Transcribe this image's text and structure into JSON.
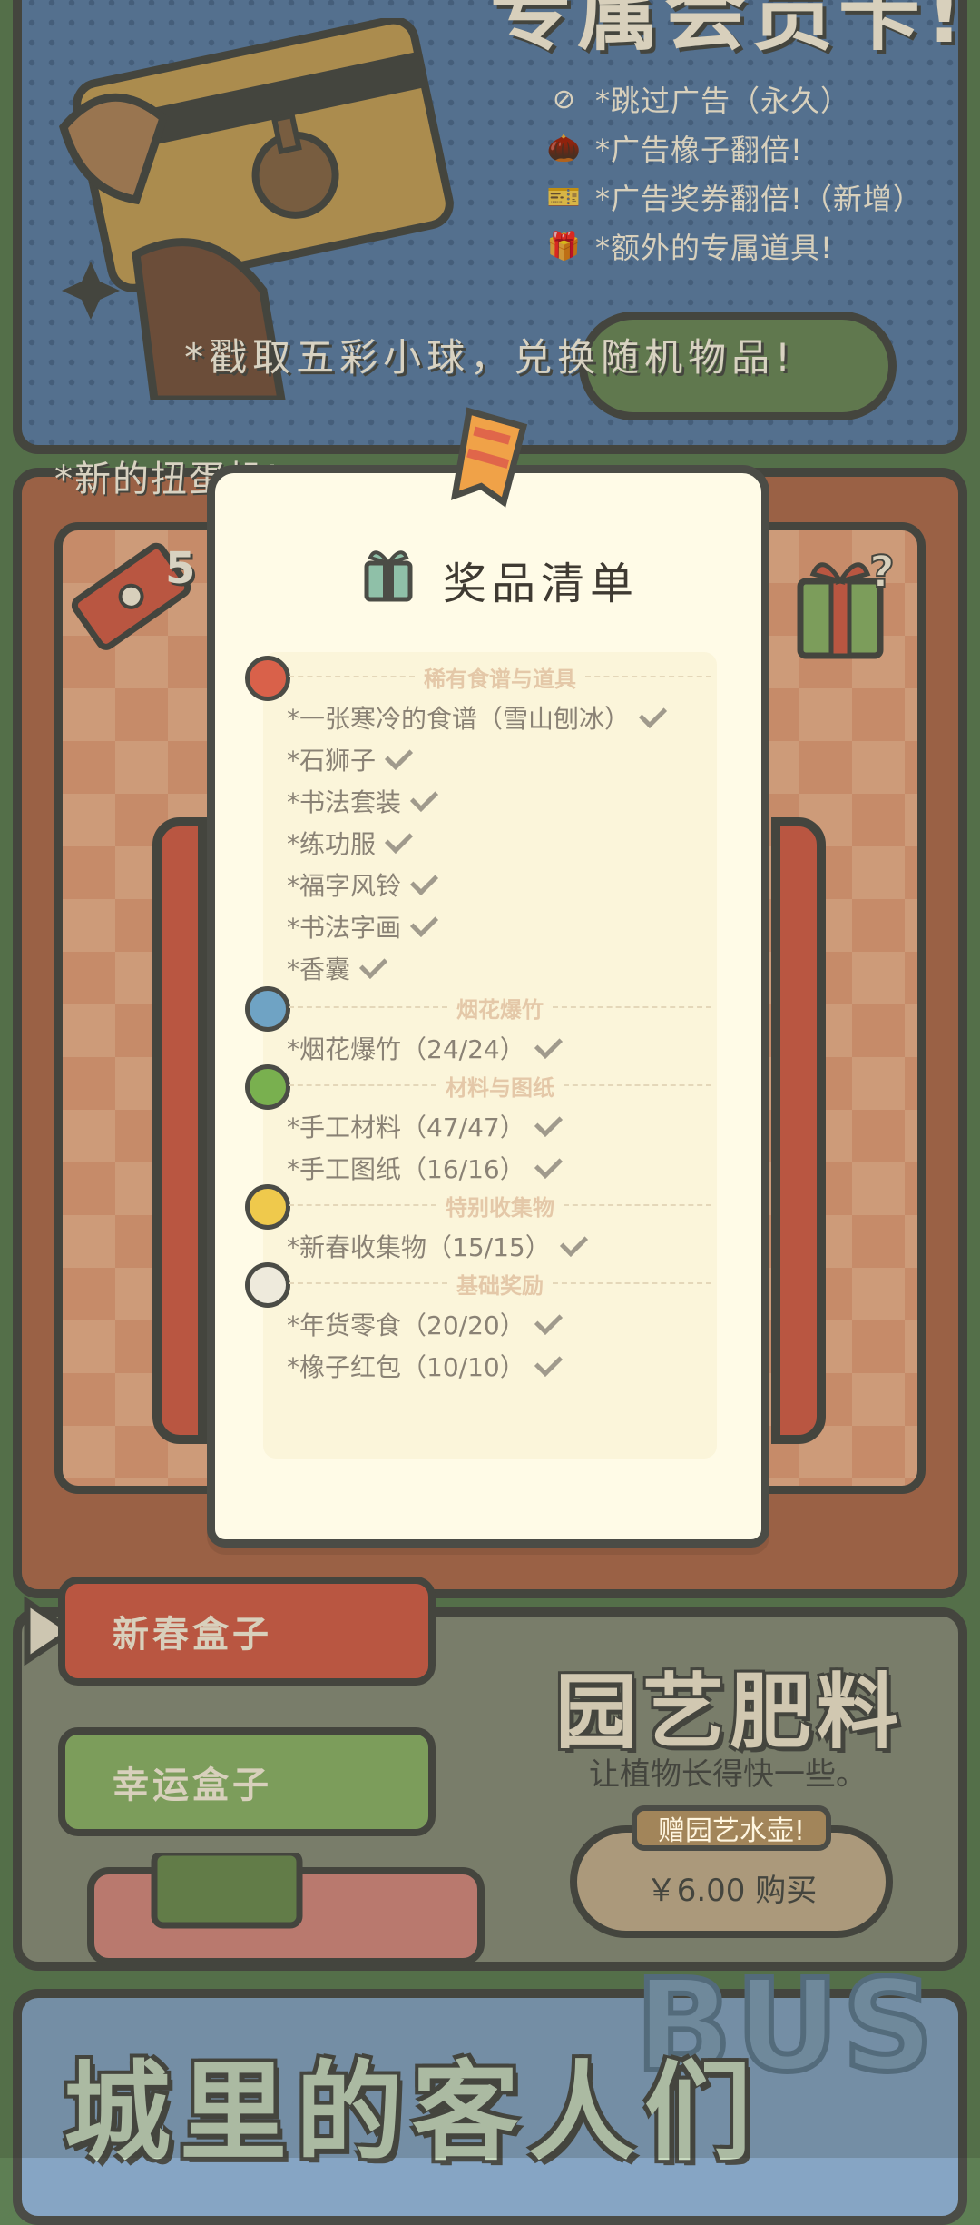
{
  "membership": {
    "title": "专属会员卡!",
    "perks": [
      {
        "icon": "no-ads-icon",
        "text": "*跳过广告（永久）"
      },
      {
        "icon": "acorn-icon",
        "text": "*广告橡子翻倍!"
      },
      {
        "icon": "ticket-icon",
        "text": "*广告奖券翻倍!（新增）"
      },
      {
        "icon": "gift-icon",
        "text": "*额外的专属道具!"
      }
    ]
  },
  "gacha": {
    "lottery_line": "*戳取五彩小球，兑换随机物品!",
    "new_ball_line": "*新的扭蛋机!",
    "ticket_count": "5"
  },
  "prize_list": {
    "title": "奖品清单",
    "sections": [
      {
        "ball_color": "#d9614a",
        "header": "稀有食谱与道具",
        "items": [
          "*一张寒冷的食谱（雪山刨冰）",
          "*石狮子",
          "*书法套装",
          "*练功服",
          "*福字风铃",
          "*书法字画",
          "*香囊"
        ]
      },
      {
        "ball_color": "#6fa3c4",
        "header": "烟花爆竹",
        "items": [
          "*烟花爆竹（24/24）"
        ]
      },
      {
        "ball_color": "#79b04f",
        "header": "材料与图纸",
        "items": [
          "*手工材料（47/47）",
          "*手工图纸（16/16）"
        ]
      },
      {
        "ball_color": "#efc94c",
        "header": "特别收集物",
        "items": [
          "*新春收集物（15/15）"
        ]
      },
      {
        "ball_color": "#eeeadc",
        "header": "基础奖励",
        "items": [
          "*年货零食（20/20）",
          "*橡子红包（10/10）"
        ]
      }
    ]
  },
  "shop": {
    "tabs": [
      {
        "label": "新春盒子",
        "color": "#d9614a"
      },
      {
        "label": "幸运盒子",
        "color": "#8fb86a"
      }
    ],
    "fertilizer": {
      "title": "园艺肥料",
      "desc": "让植物长得快一些。",
      "badge": "赠园艺水壶!",
      "buy_label": "￥6.00 购买"
    }
  },
  "city": {
    "title": "城里的客人们",
    "bus_text": "BUS"
  }
}
